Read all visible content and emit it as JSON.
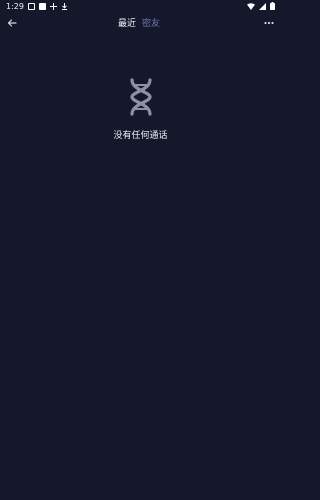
{
  "status_bar": {
    "time": "1:29"
  },
  "header": {
    "tabs": [
      {
        "label": "最近"
      },
      {
        "label": "密友"
      }
    ]
  },
  "empty_state": {
    "message": "没有任何通话",
    "icon": "dna-icon"
  },
  "colors": {
    "background": "#15182b",
    "active_tab": "#f3f3f8",
    "inactive_tab": "#6f76b8",
    "icon": "#8f90a8"
  }
}
